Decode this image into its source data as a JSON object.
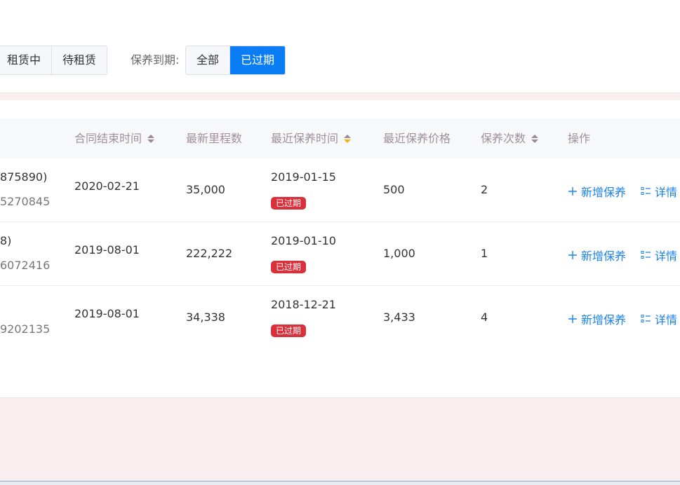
{
  "filters": {
    "rent_status_options": [
      "租赁中",
      "待租赁"
    ],
    "maintenance_label": "保养到期:",
    "maintenance_options": [
      "全部",
      "已过期"
    ],
    "maintenance_selected": "已过期",
    "colors": {
      "accent": "#0a7df5",
      "expired_badge": "#d9303c",
      "link": "#1a82e6"
    }
  },
  "table": {
    "columns": [
      {
        "label": "合同结束时间",
        "sortable": true
      },
      {
        "label": "最新里程数",
        "sortable": false
      },
      {
        "label": "最近保养时间",
        "sortable": true,
        "active_sort": "desc"
      },
      {
        "label": "最近保养价格",
        "sortable": false
      },
      {
        "label": "保养次数",
        "sortable": true
      },
      {
        "label": "操作",
        "sortable": false
      }
    ],
    "rows": [
      {
        "vehicle_line1": "875890)",
        "vehicle_line2": "5270845",
        "contract_end": "2020-02-21",
        "mileage": "35,000",
        "last_maintenance": "2019-01-15",
        "badge": "已过期",
        "price": "500",
        "count": "2",
        "action_add": "新增保养",
        "action_detail": "详情"
      },
      {
        "vehicle_line1": "8)",
        "vehicle_line2": "6072416",
        "contract_end": "2019-08-01",
        "mileage": "222,222",
        "last_maintenance": "2019-01-10",
        "badge": "已过期",
        "price": "1,000",
        "count": "1",
        "action_add": "新增保养",
        "action_detail": "详情"
      },
      {
        "vehicle_line1": "",
        "vehicle_line2": "9202135",
        "contract_end": "2019-08-01",
        "mileage": "34,338",
        "last_maintenance": "2018-12-21",
        "badge": "已过期",
        "price": "3,433",
        "count": "4",
        "action_add": "新增保养",
        "action_detail": "详情"
      }
    ]
  }
}
